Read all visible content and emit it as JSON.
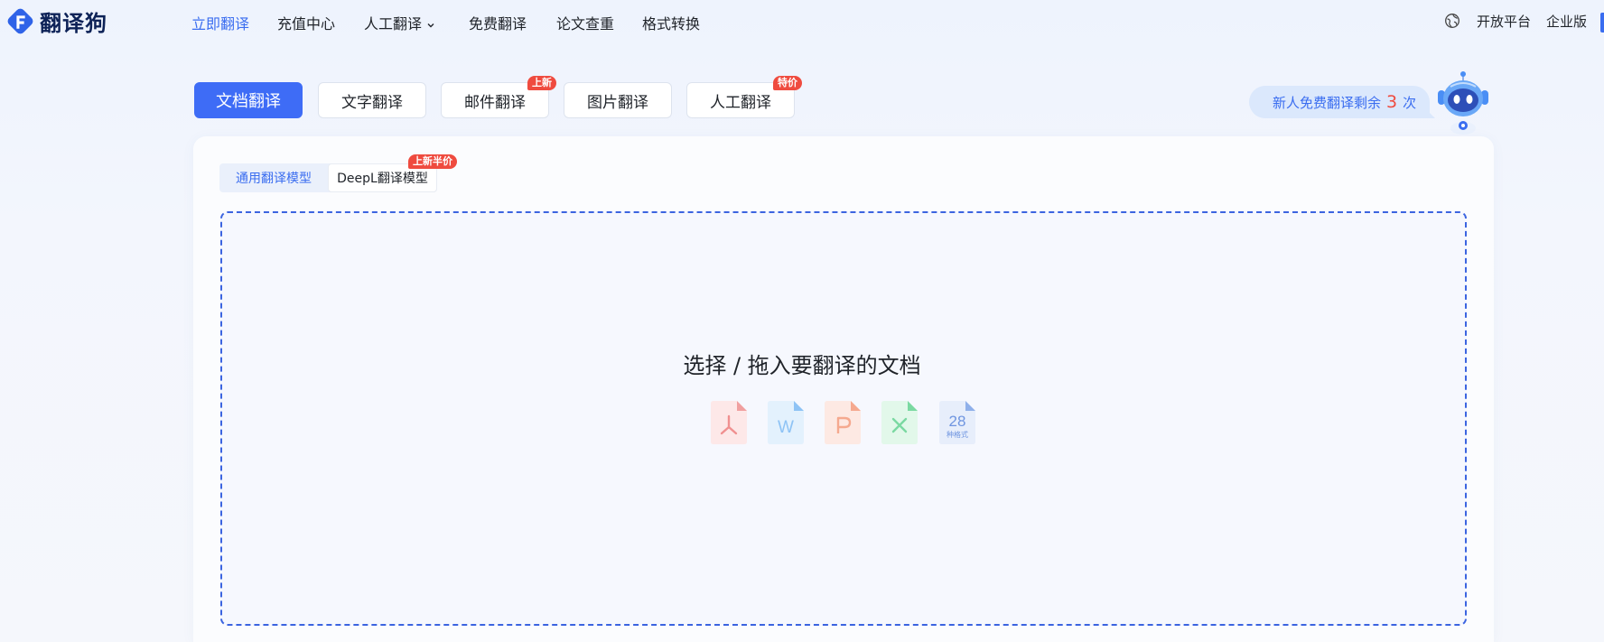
{
  "brand": {
    "name": "翻译狗"
  },
  "nav": {
    "items": [
      {
        "label": "立即翻译",
        "active": true
      },
      {
        "label": "充值中心"
      },
      {
        "label": "人工翻译",
        "has_dropdown": true
      },
      {
        "label": "免费翻译"
      },
      {
        "label": "论文查重"
      },
      {
        "label": "格式转换"
      }
    ],
    "right": {
      "open_platform": "开放平台",
      "enterprise": "企业版"
    }
  },
  "tabs": [
    {
      "label": "文档翻译",
      "active": true
    },
    {
      "label": "文字翻译"
    },
    {
      "label": "邮件翻译",
      "badge": "上新"
    },
    {
      "label": "图片翻译"
    },
    {
      "label": "人工翻译",
      "badge": "特价"
    }
  ],
  "promo": {
    "prefix": "新人免费翻译剩余",
    "count": "3",
    "suffix": "次"
  },
  "models": {
    "general": "通用翻译模型",
    "deepl": "DeepL翻译模型",
    "deepl_badge": "上新半价"
  },
  "dropzone": {
    "title": "选择 / 拖入要翻译的文档",
    "formats": [
      {
        "icon": "pdf-icon"
      },
      {
        "icon": "word-icon",
        "glyph": "W"
      },
      {
        "icon": "ppt-icon"
      },
      {
        "icon": "excel-icon"
      },
      {
        "icon": "more-formats-icon",
        "count": "28",
        "caption": "种格式"
      }
    ]
  },
  "colors": {
    "accent": "#3e6cf6",
    "badge": "#ef4b3f",
    "dropzone_border": "#3b64e0",
    "pdf": "#f0a0a0",
    "word": "#8ec3f5",
    "ppt": "#f5a98f",
    "excel": "#7bd9a2",
    "more": "#8fb0ea"
  }
}
